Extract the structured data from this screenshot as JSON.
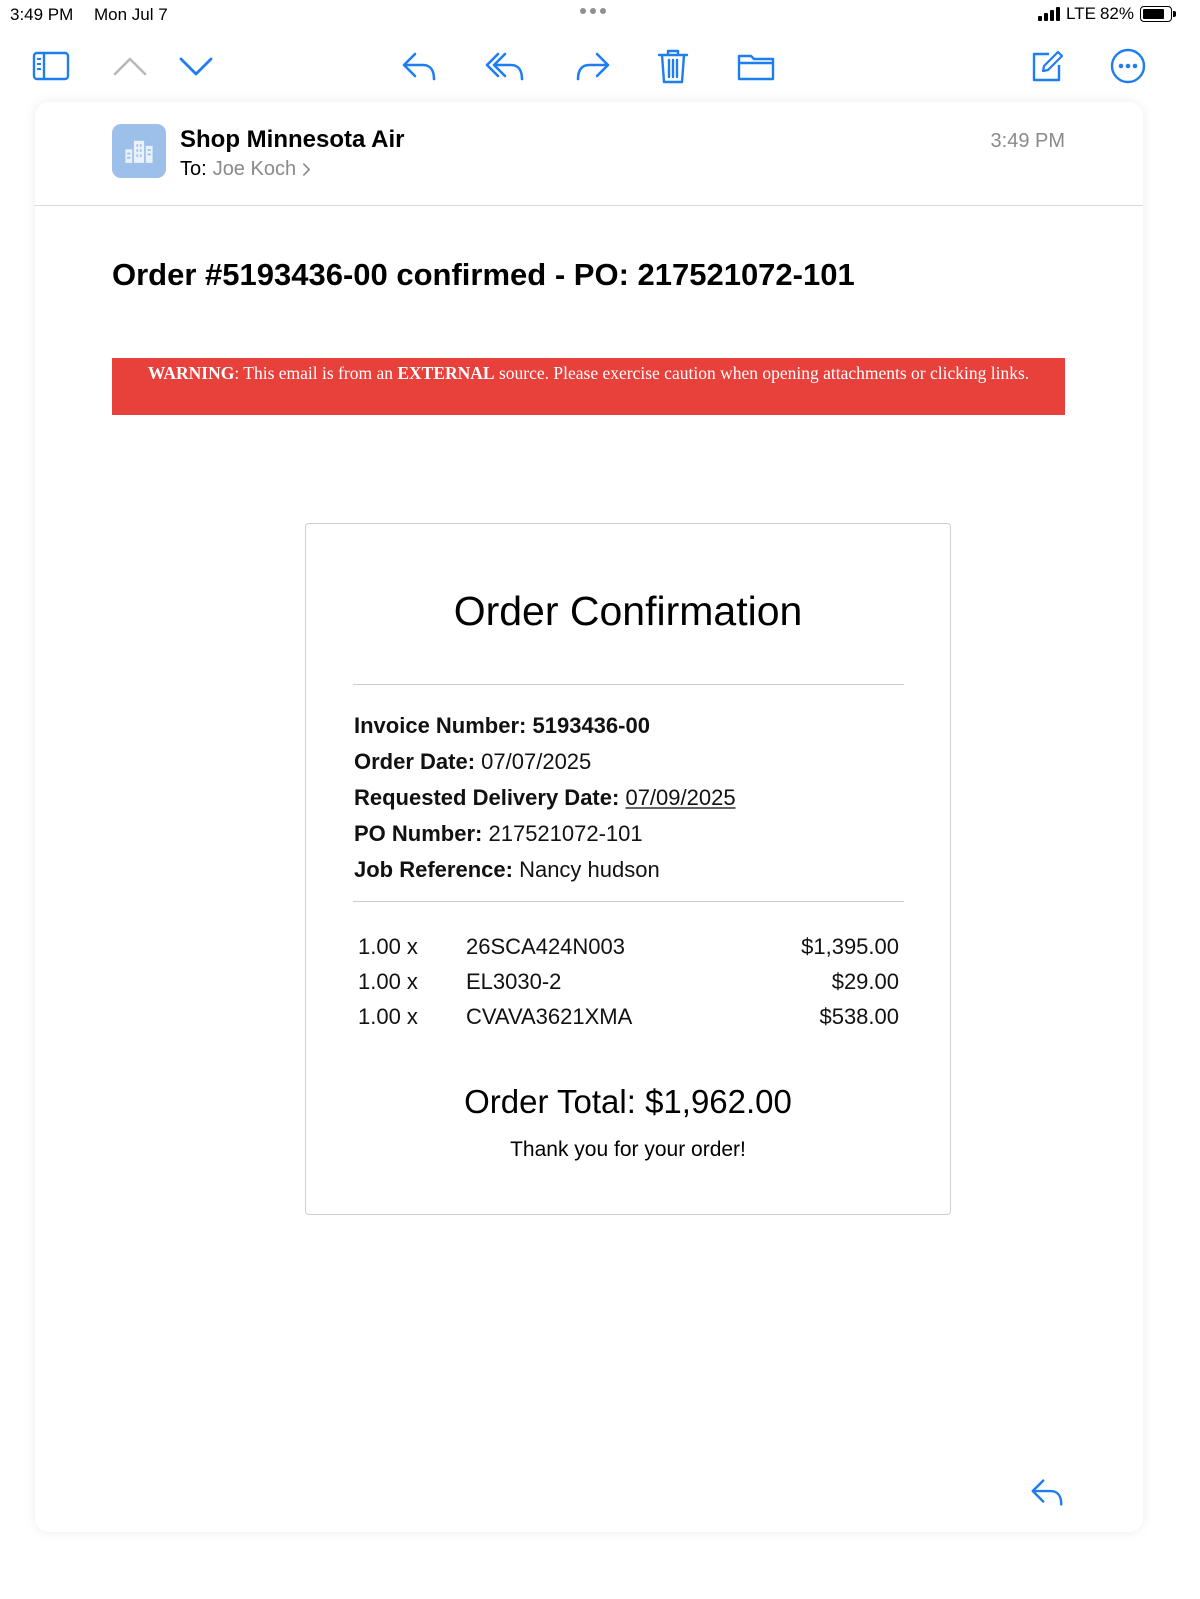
{
  "status_bar": {
    "time": "3:49 PM",
    "date": "Mon Jul 7",
    "network": "LTE",
    "battery": "82%",
    "battery_level": 0.82
  },
  "toolbar": {
    "icons": [
      "sidebar-icon",
      "chevron-up-icon",
      "chevron-down-icon",
      "reply-icon",
      "reply-all-icon",
      "forward-icon",
      "trash-icon",
      "folder-icon",
      "compose-icon",
      "more-icon"
    ],
    "accent": "#1e7ef0"
  },
  "email": {
    "sender": "Shop Minnesota Air",
    "to_label": "To:",
    "to_name": "Joe Koch",
    "time": "3:49 PM",
    "subject": "Order #5193436-00 confirmed - PO: 217521072-101",
    "warning": {
      "label": "WARNING",
      "text_1": ": This email is from an ",
      "emphasis": "EXTERNAL",
      "text_2": " source. Please exercise caution when opening attachments or clicking links.",
      "color": "#e8403b"
    }
  },
  "order": {
    "title": "Order Confirmation",
    "invoice_label": "Invoice Number:",
    "invoice_value": "5193436-00",
    "order_date_label": "Order Date:",
    "order_date_value": "07/07/2025",
    "delivery_label": "Requested Delivery Date:",
    "delivery_value": "07/09/2025",
    "po_label": "PO Number:",
    "po_value": "217521072-101",
    "job_label": "Job Reference:",
    "job_value": "Nancy hudson",
    "items": [
      {
        "qty": "1.00 x",
        "sku": "26SCA424N003",
        "price": "$1,395.00"
      },
      {
        "qty": "1.00 x",
        "sku": "EL3030-2",
        "price": "$29.00"
      },
      {
        "qty": "1.00 x",
        "sku": "CVAVA3621XMA",
        "price": "$538.00"
      }
    ],
    "total": "Order Total: $1,962.00",
    "thanks": "Thank you for your order!"
  }
}
